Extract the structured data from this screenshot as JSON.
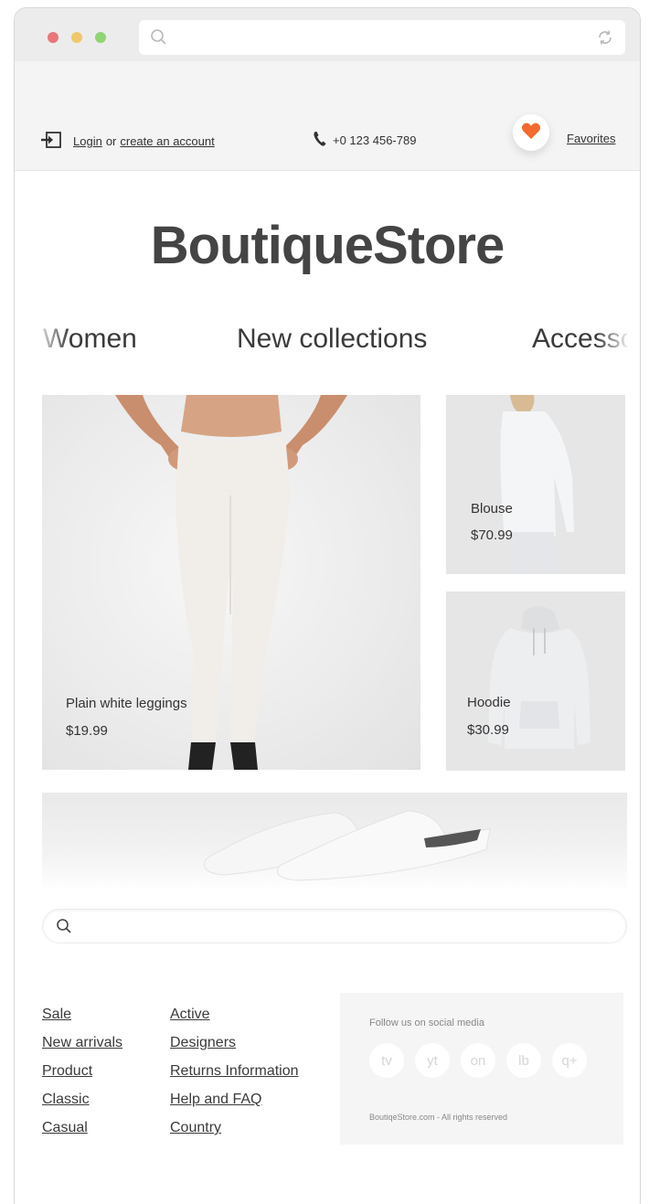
{
  "browser": {
    "url_value": ""
  },
  "topbar": {
    "login_label": "Login",
    "or_label": "or",
    "create_account_label": "create an account",
    "phone": "+0 123 456-789",
    "favorites_label": "Favorites"
  },
  "brand": {
    "logo_text": "BoutiqueStore"
  },
  "nav": {
    "items": [
      "Women",
      "New collections",
      "Accessories"
    ]
  },
  "products": [
    {
      "name": "Plain white leggings",
      "price": "$19.99"
    },
    {
      "name": "Blouse",
      "price": "$70.99"
    },
    {
      "name": "Hoodie",
      "price": "$30.99"
    }
  ],
  "search": {
    "value": "",
    "placeholder": ""
  },
  "footer": {
    "col1": [
      "Sale",
      "New arrivals",
      "Product",
      "Classic",
      "Casual"
    ],
    "col2": [
      "Active",
      "Designers",
      "Returns Information",
      "Help and FAQ",
      "Country"
    ]
  },
  "social": {
    "title": "Follow us on social media",
    "buttons": [
      "tv",
      "yt",
      "on",
      "lb",
      "q+"
    ],
    "copyright": "BoutiqeStore.com - All rights reserved"
  },
  "colors": {
    "heart": "#f26a2e",
    "window_chrome": "#ececec",
    "dot_red": "#e8767a",
    "dot_yellow": "#eec86a",
    "dot_green": "#8fd572"
  }
}
